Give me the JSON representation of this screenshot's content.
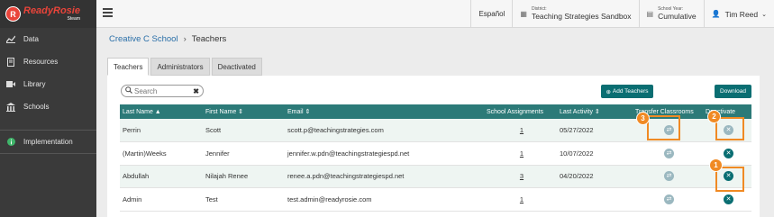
{
  "app": {
    "logo_name": "ReadyRosie",
    "logo_sub": "Steam"
  },
  "sidebar": {
    "items": [
      {
        "label": "Data",
        "icon": "chart-icon"
      },
      {
        "label": "Resources",
        "icon": "document-icon"
      },
      {
        "label": "Library",
        "icon": "video-icon"
      },
      {
        "label": "Schools",
        "icon": "building-icon"
      }
    ],
    "implementation": {
      "label": "Implementation",
      "icon": "info-icon"
    }
  },
  "topbar": {
    "language": "Español",
    "district_label": "District:",
    "district_value": "Teaching Strategies Sandbox",
    "school_year_label": "School Year:",
    "school_year_value": "Cumulative",
    "user": "Tim Reed"
  },
  "breadcrumb": {
    "school": "Creative C School",
    "current": "Teachers"
  },
  "tabs": [
    "Teachers",
    "Administrators",
    "Deactivated"
  ],
  "search": {
    "placeholder": "Search"
  },
  "buttons": {
    "add_teachers": "Add Teachers",
    "download": "Download"
  },
  "table": {
    "headers": {
      "last_name": "Last Name",
      "first_name": "First Name",
      "email": "Email",
      "school_assignments": "School Assignments",
      "last_activity": "Last Activity",
      "transfer": "Transfer Classrooms",
      "deactivate": "Deactivate"
    },
    "rows": [
      {
        "last": "Perrin",
        "first": "Scott",
        "email": "scott.p@teachingstrategies.com",
        "assign": "1",
        "activity": "05/27/2022"
      },
      {
        "last": "(Martin)Weeks",
        "first": "Jennifer",
        "email": "jennifer.w.pdn@teachingstrategiespd.net",
        "assign": "1",
        "activity": "10/07/2022"
      },
      {
        "last": "Abdullah",
        "first": "Nilajah Renee",
        "email": "renee.a.pdn@teachingstrategiespd.net",
        "assign": "3",
        "activity": "04/20/2022"
      },
      {
        "last": "Admin",
        "first": "Test",
        "email": "test.admin@readyrosie.com",
        "assign": "1",
        "activity": ""
      }
    ]
  },
  "callouts": [
    "1",
    "2",
    "3"
  ],
  "colors": {
    "teal": "#2c7a78",
    "button": "#0a6e72",
    "accent": "#f08a24",
    "link": "#2a6fa8"
  }
}
